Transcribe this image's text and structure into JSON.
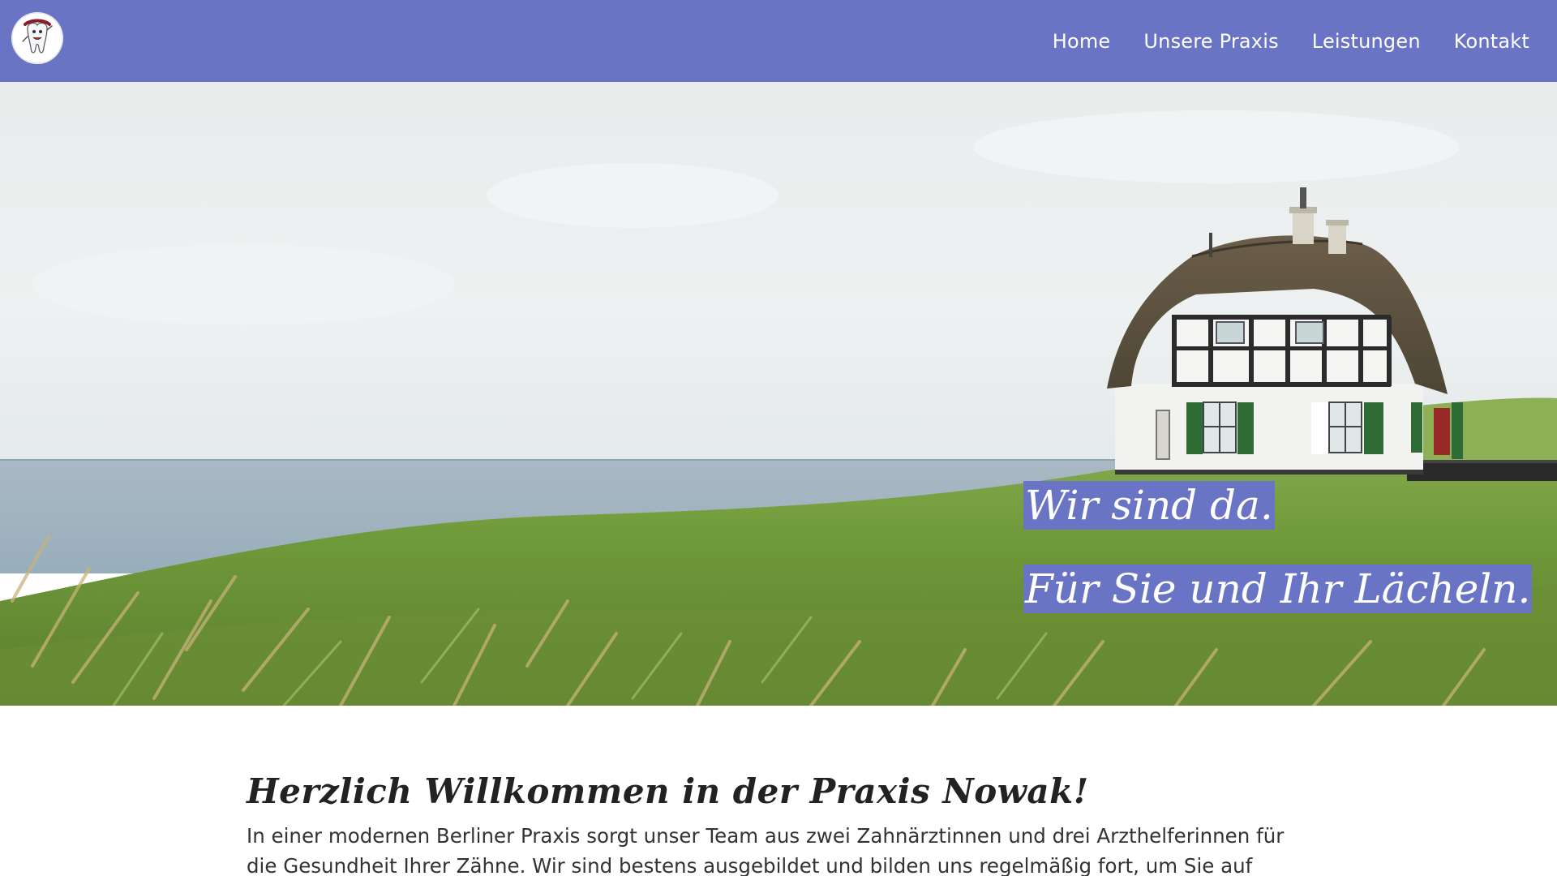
{
  "header": {
    "logo_icon": "tooth-mascot-icon",
    "nav": [
      {
        "label": "Home"
      },
      {
        "label": "Unsere Praxis"
      },
      {
        "label": "Leistungen"
      },
      {
        "label": "Kontakt"
      }
    ]
  },
  "hero": {
    "tagline_1": "Wir sind da.",
    "tagline_2": "Für Sie und Ihr Lächeln."
  },
  "content": {
    "title": "Herzlich Willkommen in der Praxis Nowak!",
    "intro": "In einer modernen Berliner Praxis sorgt unser Team aus zwei Zahnärztinnen und drei Arzthelferinnen für die Gesundheit Ihrer Zähne. Wir sind bestens ausgebildet und bilden uns regelmäßig fort, um Sie auf dem neuesten"
  },
  "colors": {
    "brand": "#6a74c4",
    "text": "#2b2b2b",
    "background": "#ffffff"
  }
}
